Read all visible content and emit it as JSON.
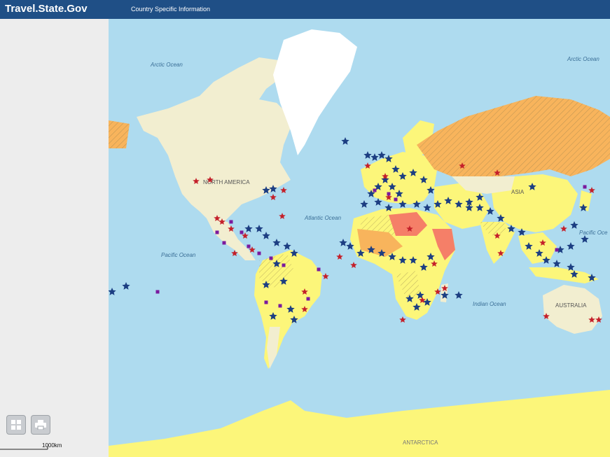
{
  "header": {
    "brand": "Travel.State.Gov",
    "nav_link": "Country Specific Information"
  },
  "toolbar": {
    "grid_icon": "grid-icon",
    "print_icon": "print-icon"
  },
  "scale": {
    "label": "1000km"
  },
  "map": {
    "labels": {
      "arctic_ocean_west": "Arctic Ocean",
      "arctic_ocean_east": "Arctic Ocean",
      "north_america": "NORTH AMERICA",
      "asia": "ASIA",
      "atlantic_ocean": "Atlantic Ocean",
      "pacific_ocean_west": "Pacific Ocean",
      "pacific_ocean_east": "Pacific Oce",
      "indian_ocean": "Indian Ocean",
      "australia": "AUSTRALIA",
      "antarctica": "ANTARCTICA"
    },
    "colors": {
      "ocean": "#aedbef",
      "land": "#f2eed0",
      "greenland": "#ffffff",
      "advisory_yellow": "#fcf67a",
      "advisory_orange": "#f8b45c",
      "advisory_red": "#f57f68",
      "star_blue": "#1c3e82",
      "star_red": "#c4202a",
      "marker_purple": "#7a1a9e",
      "header": "#1f4f86"
    }
  }
}
